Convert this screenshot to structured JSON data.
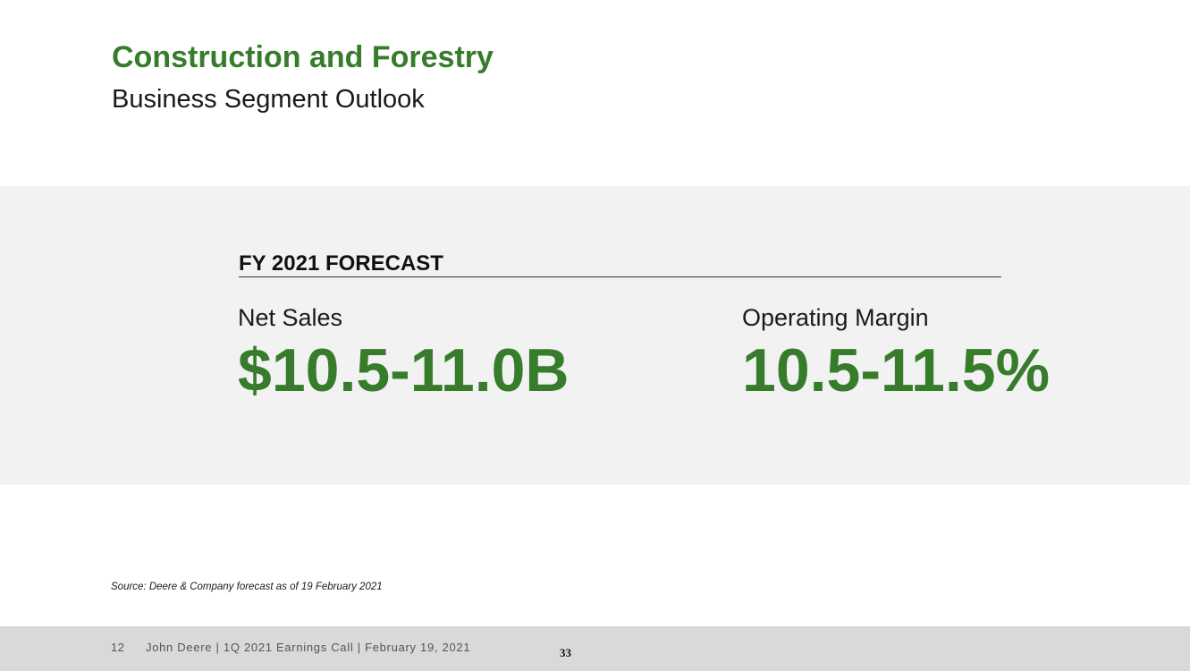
{
  "header": {
    "title": "Construction and Forestry",
    "subtitle": "Business Segment Outlook"
  },
  "forecast": {
    "heading": "FY 2021 FORECAST",
    "metrics": [
      {
        "label": "Net Sales",
        "value": "$10.5-11.0B"
      },
      {
        "label": "Operating Margin",
        "value": "10.5-11.5%"
      }
    ]
  },
  "source_note": "Source: Deere & Company forecast as of 19 February 2021",
  "footer": {
    "page_number": "12",
    "text": "John Deere | 1Q 2021 Earnings Call | February 19, 2021",
    "slide_marker": "33"
  },
  "colors": {
    "brand_green": "#367c2b",
    "panel_gray": "#f2f2f2",
    "footer_gray": "#d9d9d9"
  }
}
